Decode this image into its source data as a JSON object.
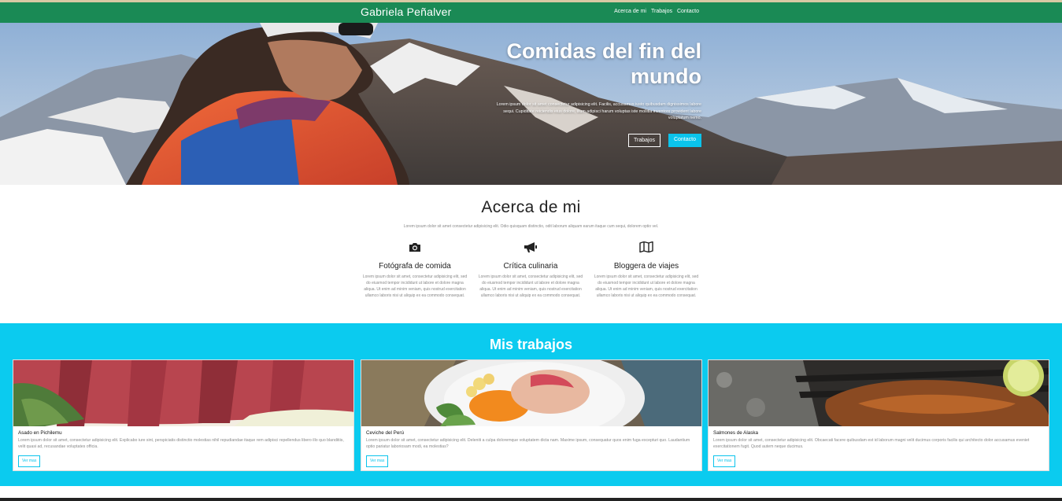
{
  "nav": {
    "brand": "Gabriela Peñalver",
    "links": [
      "Acerca de mi",
      "Trabajos",
      "Contacto"
    ]
  },
  "hero": {
    "title": "Comidas del fin del mundo",
    "text": "Lorem ipsum dolor sit amet consectetur adipisicing elit. Facilis, accusamus iusto quibusdam dignissimos labore sequi. Cupiditate reiciendis eius dolore, illum adipisci harum voluptas iste mollitia inventore provident labore voluptatum nemo.",
    "btn_trabajos": "Trabajos",
    "btn_contacto": "Contacto"
  },
  "about": {
    "title": "Acerca de mi",
    "intro": "Lorem ipsum dolor sit amet consectetur adipisicing elit. Odio quisquam distinctio, odit laborum aliquam earum itaque cum sequi, dolorem optio vel.",
    "features": [
      {
        "icon": "camera-icon",
        "title": "Fotógrafa de comida",
        "text": "Lorem ipsum dolor sit amet, consectetur adipisicing elit, sed do eiusmod tempor incididunt ut labore et dolore magna aliqua. Ut enim ad minim veniam, quis nostrud exercitation ullamco laboris nisi ut aliquip ex ea commodo consequat."
      },
      {
        "icon": "megaphone-icon",
        "title": "Crítica culinaria",
        "text": "Lorem ipsum dolor sit amet, consectetur adipisicing elit, sed do eiusmod tempor incididunt ut labore et dolore magna aliqua. Ut enim ad minim veniam, quis nostrud exercitation ullamco laboris nisi ut aliquip ex ea commodo consequat."
      },
      {
        "icon": "map-icon",
        "title": "Bloggera de viajes",
        "text": "Lorem ipsum dolor sit amet, consectetur adipisicing elit, sed do eiusmod tempor incididunt ut labore et dolore magna aliqua. Ut enim ad minim veniam, quis nostrud exercitation ullamco laboris nisi ut aliquip ex ea commodo consequat."
      }
    ]
  },
  "works": {
    "title": "Mis trabajos",
    "cards": [
      {
        "title": "Asado en Pichilemu",
        "text": "Lorem ipsum dolor sit amet, consectetur adipisicing elit. Explicabo iure sint, perspiciatis distinctio molestias nihil repudiandae itaque rem adipisci repellendus libero illo quo blanditiis, velit quasi ad, recusandae voluptates officia.",
        "button": "Ver mas"
      },
      {
        "title": "Ceviche del Perú",
        "text": "Lorem ipsum dolor sit amet, consectetur adipisicing elit. Deleniti a culpa doloremque voluptatem dicta nam. Maxime ipsum, consequatur quos enim fuga excepturi quo. Laudantium optio pariatur laboriosam modi, ea molestias?",
        "button": "Ver mas"
      },
      {
        "title": "Salmones de Alaska",
        "text": "Lorem ipsum dolor sit amet, consectetur adipisicing elit. Obcaecati facere quibusdam est id laborum magni velit ducimus corporis facilis qui architecto dolor accusamus eveniet exercitationem fugit. Quod autem neque ducimus.",
        "button": "Ver mas"
      }
    ]
  },
  "colors": {
    "navbar": "#1a8a55",
    "accent": "#0bc4ec",
    "works_bg": "#0bcbef"
  }
}
